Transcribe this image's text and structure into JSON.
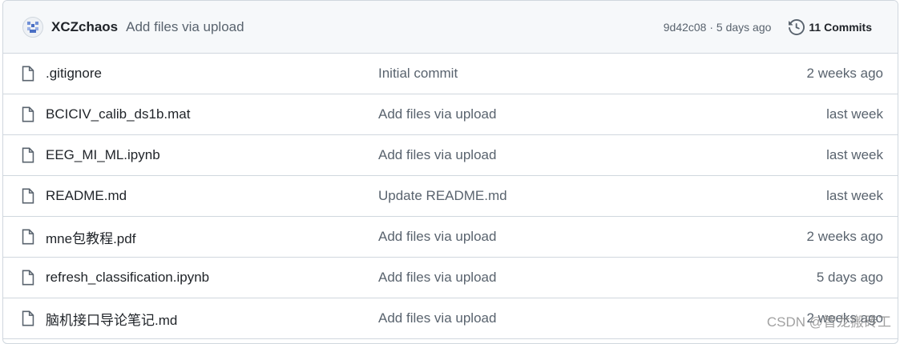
{
  "commit_header": {
    "author": "XCZchaos",
    "message": "Add files via upload",
    "sha_date": "9d42c08 · 5 days ago",
    "commits_label": "11 Commits"
  },
  "files": [
    {
      "name": ".gitignore",
      "commit": "Initial commit",
      "age": "2 weeks ago"
    },
    {
      "name": "BCICIV_calib_ds1b.mat",
      "commit": "Add files via upload",
      "age": "last week"
    },
    {
      "name": "EEG_MI_ML.ipynb",
      "commit": "Add files via upload",
      "age": "last week"
    },
    {
      "name": "README.md",
      "commit": "Update README.md",
      "age": "last week"
    },
    {
      "name": "mne包教程.pdf",
      "commit": "Add files via upload",
      "age": "2 weeks ago"
    },
    {
      "name": "refresh_classification.ipynb",
      "commit": "Add files via upload",
      "age": "5 days ago"
    },
    {
      "name": "脑机接口导论笔记.md",
      "commit": "Add files via upload",
      "age": "2 weeks ago"
    }
  ],
  "watermark": "CSDN @智龙搬砖工",
  "colors": {
    "header_bg": "#f6f8fa",
    "border": "#d0d7de",
    "text_primary": "#1f2328",
    "text_muted": "#59636e"
  },
  "icons": {
    "avatar": "identicon-avatar",
    "history": "history-icon",
    "file": "file-icon"
  }
}
